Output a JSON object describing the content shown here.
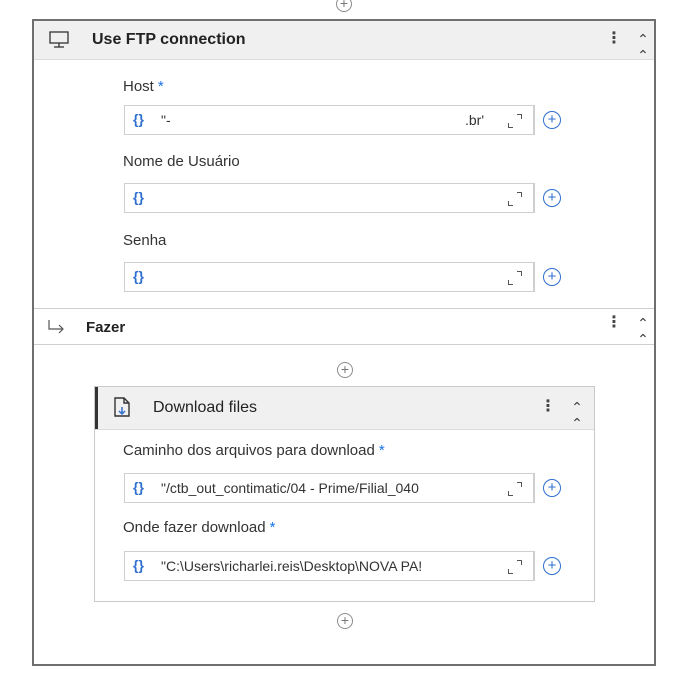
{
  "workflow": {
    "top_add_icon": "add-activity-icon",
    "ftp_connection": {
      "title": "Use FTP connection",
      "icon": "monitor-icon",
      "menu_icon": "more-options-icon",
      "collapse_icon": "collapse-icon",
      "fields": [
        {
          "label": "Host",
          "required": true,
          "required_mark": "*",
          "value_prefix": "{}",
          "value": "\"-",
          "value_tail": ".br'"
        },
        {
          "label": "Nome de Usuário",
          "required": false,
          "required_mark": "",
          "value_prefix": "{}",
          "value": "",
          "value_tail": ""
        },
        {
          "label": "Senha",
          "required": false,
          "required_mark": "",
          "value_prefix": "{}",
          "value": "",
          "value_tail": ""
        }
      ]
    },
    "do_section": {
      "title": "Fazer",
      "icon": "branch-arrow-icon",
      "menu_icon": "more-options-icon",
      "collapse_icon": "collapse-icon"
    },
    "download_files": {
      "title": "Download files",
      "icon": "download-file-icon",
      "menu_icon": "more-options-icon",
      "collapse_icon": "collapse-icon",
      "fields": [
        {
          "label": "Caminho dos arquivos para download",
          "required": true,
          "required_mark": "*",
          "value_prefix": "{}",
          "value": "\"/ctb_out_contimatic/04 - Prime/Filial_040"
        },
        {
          "label": "Onde fazer download",
          "required": true,
          "required_mark": "*",
          "value_prefix": "{}",
          "value": "\"C:\\Users\\richarlei.reis\\Desktop\\NOVA PA!"
        }
      ]
    }
  }
}
